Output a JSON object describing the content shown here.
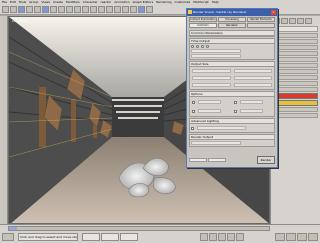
{
  "menu": [
    "File",
    "Edit",
    "Tools",
    "Group",
    "Views",
    "Create",
    "Modifiers",
    "Character",
    "reactor",
    "Animation",
    "Graph Editors",
    "Rendering",
    "Customize",
    "MAXScript",
    "Help"
  ],
  "viewport": {
    "label": "Camera01"
  },
  "render_dialog": {
    "title": "Render Scene: mental ray Renderer",
    "tabs": [
      "Indirect Illumination",
      "Processing",
      "Render Elements",
      "Common",
      "Renderer",
      ""
    ],
    "section_labels": [
      "Common Parameters",
      "Time Output",
      "Output Size",
      "Options",
      "Advanced Lighting",
      "Render Output"
    ],
    "render_button": "Render"
  },
  "status": {
    "text": "Click and drag to select and move objects"
  },
  "colors": {
    "accent": "#3b5fa9"
  },
  "icons": {
    "close": "close-icon",
    "render": "render-icon",
    "camera": "camera-icon"
  }
}
